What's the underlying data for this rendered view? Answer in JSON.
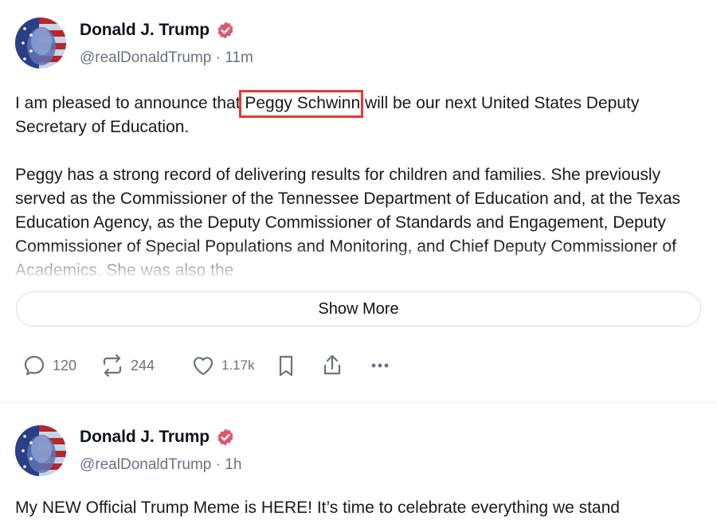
{
  "posts": [
    {
      "author": {
        "name": "Donald J. Trump",
        "handle": "@realDonaldTrump",
        "time": "11m",
        "separator": "·"
      },
      "text_before": "I am pleased to announce that ",
      "text_highlight": "Peggy Schwinn",
      "text_after": " will be our next United States Deputy Secretary of Education.",
      "paragraph2": "Peggy has a strong record of delivering results for children and families. She previously served as the Commissioner of the Tennessee Department of Education and, at the Texas Education Agency, as the Deputy Commissioner of Standards and Engagement, Deputy Commissioner of Special Populations and Monitoring, and Chief Deputy Commissioner of Academics. She was also the",
      "show_more_label": "Show More",
      "actions": {
        "replies": "120",
        "reposts": "244",
        "likes": "1.17k"
      }
    },
    {
      "author": {
        "name": "Donald J. Trump",
        "handle": "@realDonaldTrump",
        "time": "1h",
        "separator": "·"
      },
      "text": "My NEW Official Trump Meme is HERE! It’s time to celebrate everything we stand"
    }
  ],
  "colors": {
    "verified_badge": "#e0566b",
    "highlight_border": "#e53935",
    "muted_text": "#6b7280"
  },
  "icons": [
    "reply-icon",
    "repost-icon",
    "like-icon",
    "bookmark-icon",
    "share-icon",
    "more-icon",
    "verified-icon"
  ]
}
